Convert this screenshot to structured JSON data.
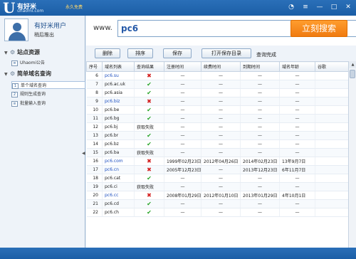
{
  "app": {
    "name": "有好米",
    "domain": "uhaomi.com",
    "tagline": "永久免费"
  },
  "window": {
    "min_icon": "minimize-icon",
    "max_icon": "maximize-icon",
    "close_icon": "close-icon"
  },
  "user": {
    "name": "有好米用户",
    "action": "稍后推出"
  },
  "sidebar": {
    "sections": [
      {
        "title": "站点资源",
        "items": [
          {
            "label": "Uhaomi公告"
          }
        ]
      },
      {
        "title": "简单域名查询",
        "items": [
          {
            "label": "单个域名查询"
          },
          {
            "label": "规则生成查询"
          },
          {
            "label": "批量输入查询"
          }
        ]
      }
    ],
    "splitter": "◀"
  },
  "search": {
    "prefix": "www.",
    "value": "pc6",
    "button": "立刻搜索"
  },
  "toolbar": {
    "delete": "删除",
    "sort": "排序",
    "save": "保存",
    "open_dir": "打开保存目录",
    "status": "查询完成"
  },
  "table": {
    "headers": [
      "序号",
      "域名列表",
      "查询结果",
      "注册时间",
      "续费时间",
      "到期时间",
      "域名年龄",
      "谷歌"
    ],
    "rows": [
      {
        "no": "6",
        "domain": "pc6.su",
        "blue": true,
        "result": "bad",
        "reg": "—",
        "renew": "—",
        "expire": "—",
        "age": "—"
      },
      {
        "no": "7",
        "domain": "pc6.ac.uk",
        "blue": false,
        "result": "ok",
        "reg": "—",
        "renew": "—",
        "expire": "—",
        "age": "—"
      },
      {
        "no": "8",
        "domain": "pc6.asia",
        "blue": false,
        "result": "ok",
        "reg": "—",
        "renew": "—",
        "expire": "—",
        "age": "—"
      },
      {
        "no": "9",
        "domain": "pc6.biz",
        "blue": true,
        "result": "bad",
        "reg": "—",
        "renew": "—",
        "expire": "—",
        "age": "—"
      },
      {
        "no": "10",
        "domain": "pc6.be",
        "blue": false,
        "result": "ok",
        "reg": "—",
        "renew": "—",
        "expire": "—",
        "age": "—"
      },
      {
        "no": "11",
        "domain": "pc6.bg",
        "blue": false,
        "result": "ok",
        "reg": "—",
        "renew": "—",
        "expire": "—",
        "age": "—"
      },
      {
        "no": "12",
        "domain": "pc6.bj",
        "blue": false,
        "result": "获取失败",
        "reg": "—",
        "renew": "—",
        "expire": "—",
        "age": "—"
      },
      {
        "no": "13",
        "domain": "pc6.br",
        "blue": false,
        "result": "ok",
        "reg": "—",
        "renew": "—",
        "expire": "—",
        "age": "—"
      },
      {
        "no": "14",
        "domain": "pc6.bz",
        "blue": false,
        "result": "ok",
        "reg": "—",
        "renew": "—",
        "expire": "—",
        "age": "—"
      },
      {
        "no": "15",
        "domain": "pc6.ba",
        "blue": false,
        "result": "获取失败",
        "reg": "—",
        "renew": "—",
        "expire": "—",
        "age": "—"
      },
      {
        "no": "16",
        "domain": "pc6.com",
        "blue": true,
        "result": "bad",
        "reg": "1999年02月23日",
        "renew": "2012年04月26日",
        "expire": "2014年02月23日",
        "age": "13年9月7日"
      },
      {
        "no": "17",
        "domain": "pc6.cn",
        "blue": true,
        "result": "bad",
        "reg": "2005年12月23日",
        "renew": "—",
        "expire": "2013年12月23日",
        "age": "6年11月7日"
      },
      {
        "no": "18",
        "domain": "pc6.cat",
        "blue": false,
        "result": "ok",
        "reg": "—",
        "renew": "—",
        "expire": "—",
        "age": "—"
      },
      {
        "no": "19",
        "domain": "pc6.ci",
        "blue": false,
        "result": "获取失败",
        "reg": "—",
        "renew": "—",
        "expire": "—",
        "age": "—"
      },
      {
        "no": "20",
        "domain": "pc6.cc",
        "blue": true,
        "result": "bad",
        "reg": "2008年01月29日",
        "renew": "2012年01月10日",
        "expire": "2013年01月29日",
        "age": "4年10月1日"
      },
      {
        "no": "21",
        "domain": "pc6.cd",
        "blue": false,
        "result": "ok",
        "reg": "—",
        "renew": "—",
        "expire": "—",
        "age": "—"
      },
      {
        "no": "22",
        "domain": "pc6.ch",
        "blue": false,
        "result": "ok",
        "reg": "—",
        "renew": "—",
        "expire": "—",
        "age": "—"
      }
    ]
  },
  "colors": {
    "titlebar": "#1b5ea6",
    "search_button": "#f07b10",
    "ok": "#26a326",
    "bad": "#d41f1f",
    "domain_blue": "#1d4fc0"
  }
}
